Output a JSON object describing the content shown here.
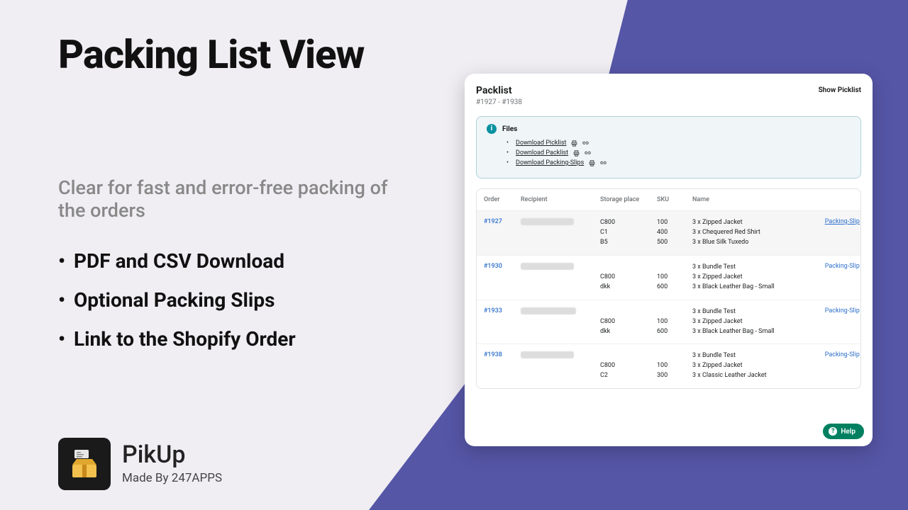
{
  "page": {
    "title": "Packing List View",
    "subhead": "Clear for fast and error-free packing of the orders",
    "bullets": [
      "PDF and CSV Download",
      "Optional Packing Slips",
      "Link to the Shopify Order"
    ]
  },
  "brand": {
    "name": "PikUp",
    "byline": "Made By 247APPS"
  },
  "panel": {
    "title": "Packlist",
    "range": "#1927 - #1938",
    "show_picklist": "Show Picklist",
    "files": {
      "heading": "Files",
      "items": [
        {
          "label": "Download Picklist"
        },
        {
          "label": "Download Packlist"
        },
        {
          "label": "Download Packing-Slips"
        }
      ]
    },
    "table": {
      "headers": {
        "order": "Order",
        "recipient": "Recipient",
        "storage": "Storage place",
        "sku": "SKU",
        "name": "Name"
      },
      "packing_slip_label": "Packing-Slip",
      "rows": [
        {
          "order": "#1927",
          "active": true,
          "packing_slip_underline": true,
          "storage": [
            "C800",
            "C1",
            "B5"
          ],
          "sku": [
            "100",
            "400",
            "500"
          ],
          "name": [
            "3 x Zipped Jacket",
            "3 x Chequered Red Shirt",
            "3 x Blue Silk Tuxedo"
          ]
        },
        {
          "order": "#1930",
          "storage": [
            "",
            "C800",
            "dkk"
          ],
          "sku": [
            "",
            "100",
            "600"
          ],
          "name": [
            "3 x Bundle Test",
            "3 x Zipped Jacket",
            "3 x Black Leather Bag - Small"
          ]
        },
        {
          "order": "#1933",
          "recipient_wide": true,
          "storage": [
            "",
            "C800",
            "dkk"
          ],
          "sku": [
            "",
            "100",
            "600"
          ],
          "name": [
            "3 x Bundle Test",
            "3 x Zipped Jacket",
            "3 x Black Leather Bag - Small"
          ]
        },
        {
          "order": "#1938",
          "storage": [
            "",
            "C800",
            "C2"
          ],
          "sku": [
            "",
            "100",
            "300"
          ],
          "name": [
            "3 x Bundle Test",
            "3 x Zipped Jacket",
            "3 x Classic Leather Jacket"
          ]
        }
      ]
    },
    "help_label": "Help"
  }
}
